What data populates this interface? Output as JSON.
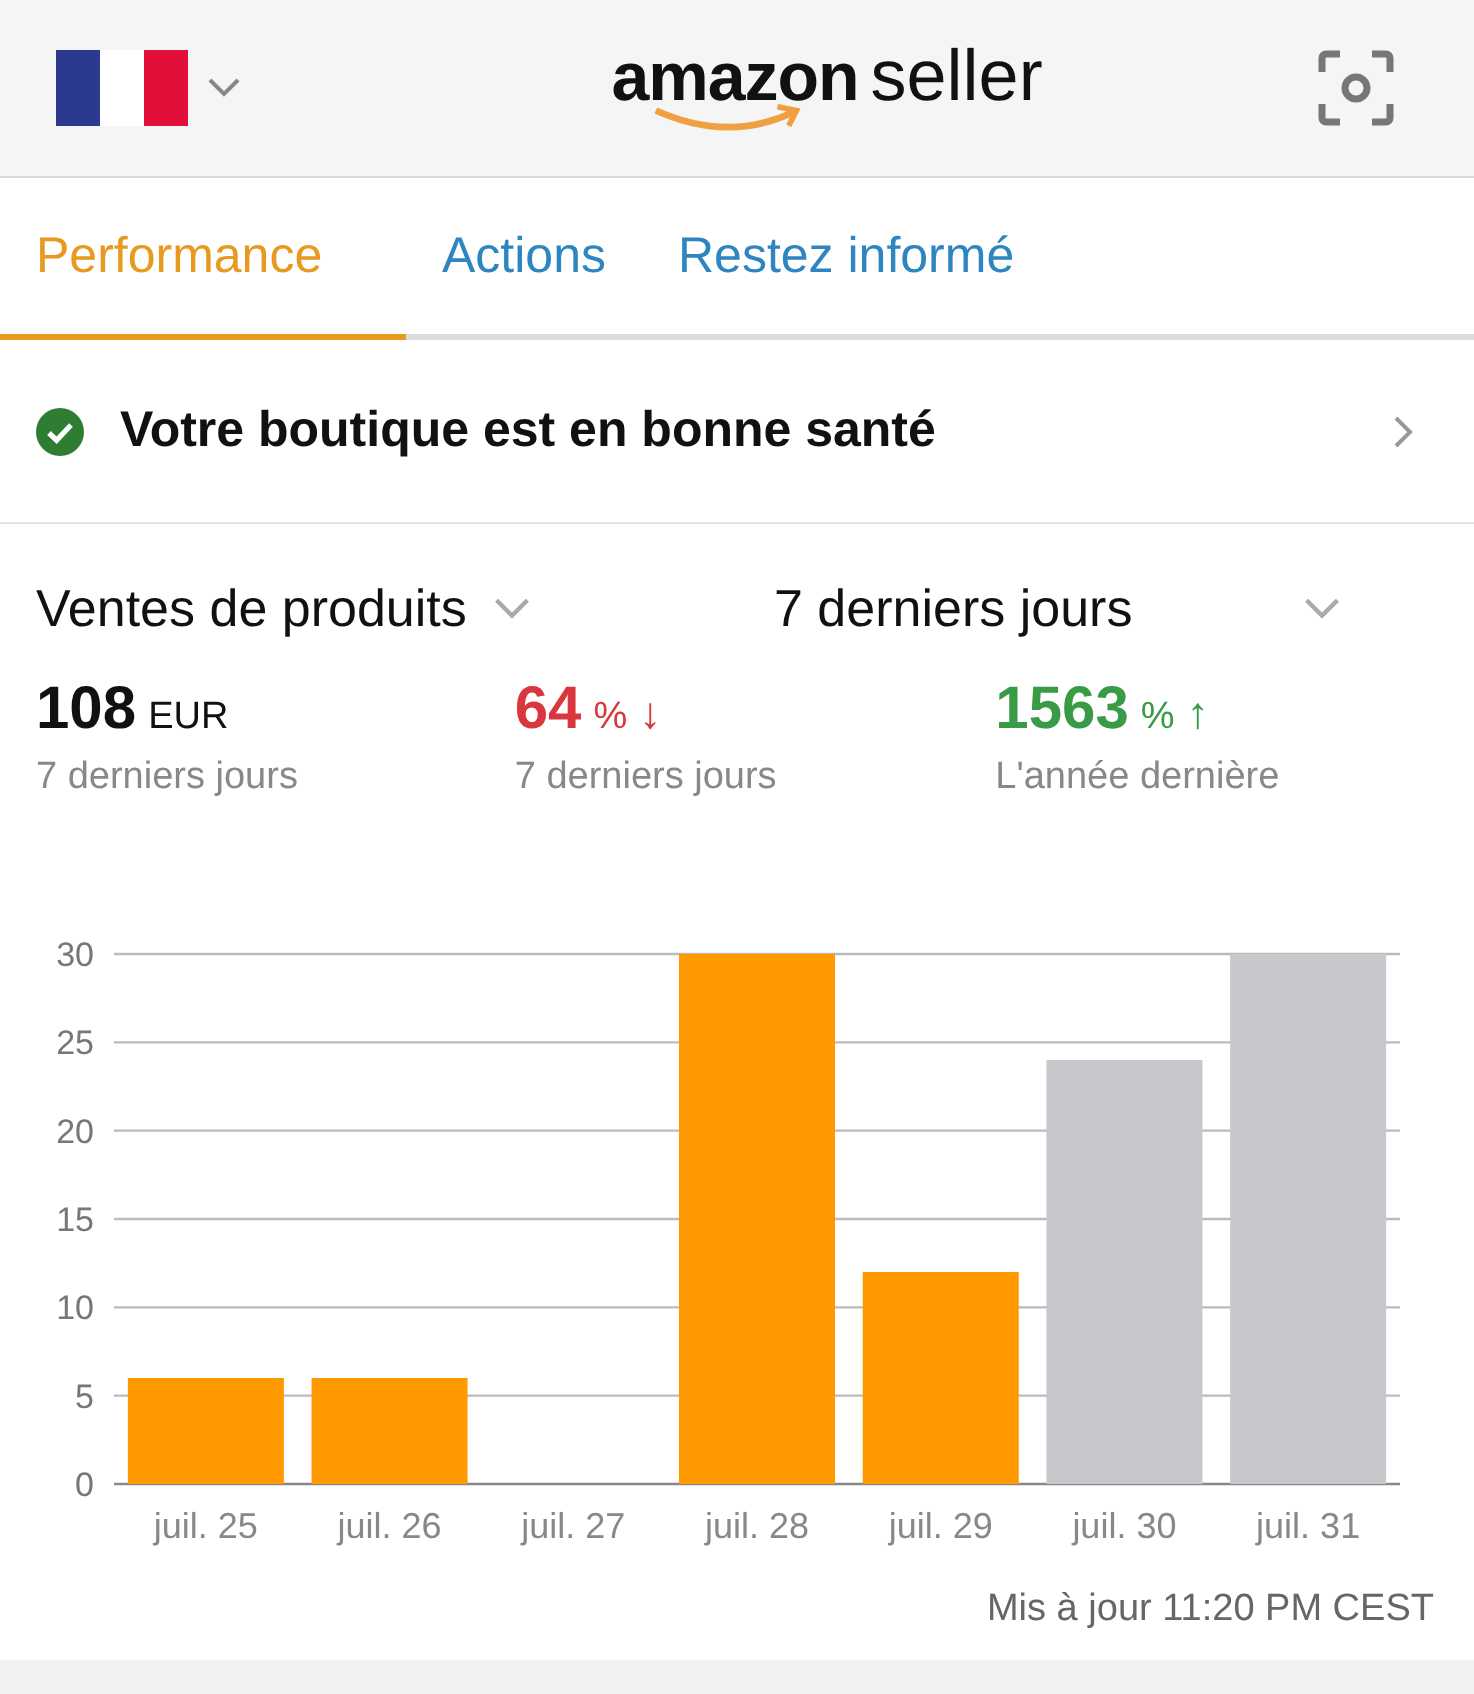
{
  "header": {
    "logo": {
      "brand": "amazon",
      "product": "seller"
    }
  },
  "tabs": [
    {
      "label": "Performance",
      "selected": true
    },
    {
      "label": "Actions",
      "selected": false
    },
    {
      "label": "Restez informé",
      "selected": false
    }
  ],
  "health_banner": {
    "text": "Votre boutique est en bonne santé"
  },
  "filters": [
    {
      "label": "Ventes de produits"
    },
    {
      "label": "7 derniers jours"
    }
  ],
  "metrics": [
    {
      "value": "108",
      "unit": "EUR",
      "color": "#111111",
      "caption": "7 derniers jours"
    },
    {
      "value": "64",
      "unit": "%",
      "arrow": "↓",
      "color": "#d9363e",
      "caption": "7 derniers jours"
    },
    {
      "value": "1563",
      "unit": "%",
      "arrow": "↑",
      "color": "#3a9b46",
      "caption": "L'année dernière"
    }
  ],
  "chart": {
    "chart_data": {
      "type": "bar",
      "grid": true,
      "categories": [
        "juil. 25",
        "juil. 26",
        "juil. 27",
        "juil. 28",
        "juil. 29",
        "juil. 30",
        "juil. 31"
      ],
      "ylim": [
        0,
        30
      ],
      "yticks": [
        0,
        5,
        10,
        15,
        20,
        25,
        30
      ],
      "series": [
        {
          "color": "#ff9900",
          "values": [
            6,
            6,
            0,
            30,
            12,
            null,
            null
          ]
        },
        {
          "color": "#c7c7cc",
          "values": [
            null,
            null,
            null,
            null,
            null,
            24,
            30
          ]
        }
      ]
    }
  },
  "footer": {
    "updated": "Mis à jour 11:20 PM CEST"
  }
}
